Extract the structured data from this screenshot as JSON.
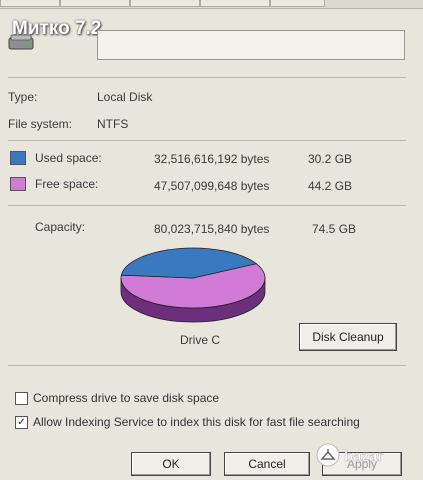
{
  "watermark": "Митко 7.2",
  "general": {
    "type_label": "Type:",
    "type_value": "Local Disk",
    "fs_label": "File system:",
    "fs_value": "NTFS"
  },
  "space": {
    "used_label": "Used space:",
    "used_bytes": "32,516,616,192 bytes",
    "used_gb": "30.2 GB",
    "used_color": "#3a78c0",
    "free_label": "Free space:",
    "free_bytes": "47,507,099,648 bytes",
    "free_gb": "44.2 GB",
    "free_color": "#d27bd6",
    "capacity_label": "Capacity:",
    "capacity_bytes": "80,023,715,840 bytes",
    "capacity_gb": "74.5 GB",
    "used_fraction": 0.406
  },
  "drive_label": "Drive C",
  "buttons": {
    "cleanup": "Disk Cleanup",
    "ok": "OK",
    "cancel": "Cancel",
    "apply": "Apply"
  },
  "options": {
    "compress": "Compress drive to save disk space",
    "compress_checked": false,
    "index": "Allow Indexing Service to index this disk for fast file searching",
    "index_checked": true
  },
  "badge": "bazar",
  "icons": [
    "drive-icon",
    "checkmark-icon",
    "hanger-icon"
  ]
}
